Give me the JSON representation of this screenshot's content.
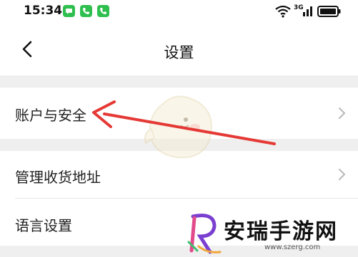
{
  "status_bar": {
    "time": "15:34",
    "network": "3G",
    "notification_icons": [
      "message-icon",
      "phone-icon",
      "phone-icon"
    ]
  },
  "header": {
    "title": "设置"
  },
  "settings": {
    "items": [
      {
        "label": "账户与安全",
        "icon": "chevron-right-icon"
      },
      {
        "label": "管理收货地址",
        "icon": "chevron-right-icon"
      },
      {
        "label": "语言设置"
      }
    ]
  },
  "annotation": {
    "arrow_color": "#e53935"
  },
  "watermark": {
    "name": "安瑞手游网",
    "url": "www.szerg.com"
  }
}
